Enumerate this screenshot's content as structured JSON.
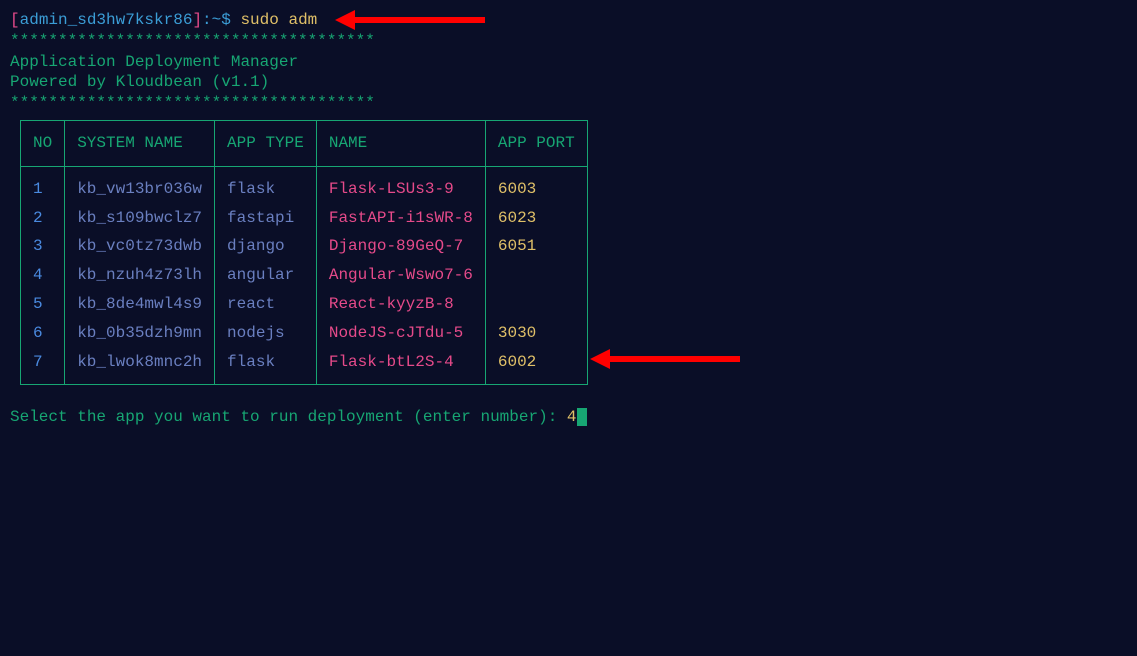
{
  "prompt": {
    "user": "admin_sd3hw7kskr86",
    "bracket_open": "[",
    "bracket_close": "]",
    "suffix": ":~$ ",
    "command": "sudo adm"
  },
  "banner": {
    "stars": "**************************************",
    "line1": "   Application Deployment Manager",
    "line2": "   Powered by Kloudbean (v1.1)"
  },
  "headers": {
    "no": "NO",
    "sysname": "SYSTEM NAME",
    "apptype": "APP TYPE",
    "name": "NAME",
    "port": "APP PORT"
  },
  "rows": [
    {
      "no": "1",
      "sysname": "kb_vw13br036w",
      "apptype": "flask",
      "name": "Flask-LSUs3-9",
      "port": "6003"
    },
    {
      "no": "2",
      "sysname": "kb_s109bwclz7",
      "apptype": "fastapi",
      "name": "FastAPI-i1sWR-8",
      "port": "6023"
    },
    {
      "no": "3",
      "sysname": "kb_vc0tz73dwb",
      "apptype": "django",
      "name": "Django-89GeQ-7",
      "port": "6051"
    },
    {
      "no": "4",
      "sysname": "kb_nzuh4z73lh",
      "apptype": "angular",
      "name": "Angular-Wswo7-6",
      "port": ""
    },
    {
      "no": "5",
      "sysname": "kb_8de4mwl4s9",
      "apptype": "react",
      "name": "React-kyyzB-8",
      "port": ""
    },
    {
      "no": "6",
      "sysname": "kb_0b35dzh9mn",
      "apptype": "nodejs",
      "name": "NodeJS-cJTdu-5",
      "port": "3030"
    },
    {
      "no": "7",
      "sysname": "kb_lwok8mnc2h",
      "apptype": "flask",
      "name": "Flask-btL2S-4",
      "port": "6002"
    }
  ],
  "select_prompt": "Select the app you want to run deployment (enter number): ",
  "select_input": "4"
}
